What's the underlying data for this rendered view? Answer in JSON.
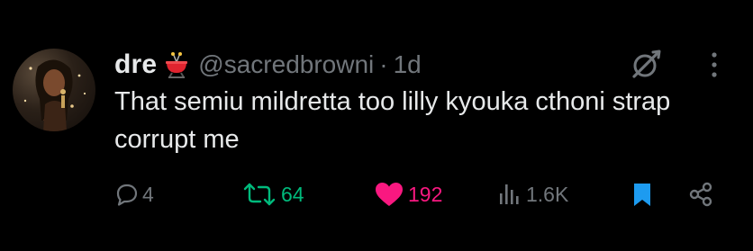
{
  "tweet": {
    "display_name": "dre",
    "handle": "@sacredbrowni",
    "separator": "·",
    "time": "1d",
    "text": "That semiu mildretta too lilly kyouka cthoni strap corrupt me"
  },
  "actions": {
    "replies": "4",
    "retweets": "64",
    "likes": "192",
    "views": "1.6K"
  },
  "icons": {
    "reply": "reply-icon",
    "retweet": "retweet-icon",
    "like": "heart-icon",
    "views": "analytics-icon",
    "bookmark": "bookmark-icon",
    "share": "share-icon",
    "grok": "grok-icon",
    "more": "more-icon",
    "name_emoji": "fondue-emoji"
  },
  "colors": {
    "background": "#000000",
    "text": "#e7e9ea",
    "muted": "#71767b",
    "retweet": "#00ba7c",
    "like": "#f91880",
    "bookmark": "#1d9bf0"
  }
}
